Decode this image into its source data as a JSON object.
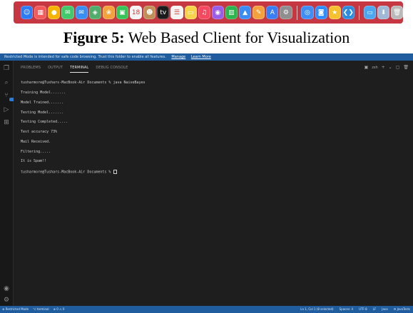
{
  "dock": {
    "apps": [
      {
        "name": "finder-icon",
        "glyph": "☺",
        "color": "#2d7cf6"
      },
      {
        "name": "launchpad-icon",
        "glyph": "▦",
        "color": "#f25a5a"
      },
      {
        "name": "chrome-icon",
        "glyph": "●",
        "color": "#f5b400"
      },
      {
        "name": "messages-icon",
        "glyph": "✉",
        "color": "#42c96b"
      },
      {
        "name": "mail-icon",
        "glyph": "✉",
        "color": "#3a8ef3"
      },
      {
        "name": "maps-icon",
        "glyph": "◈",
        "color": "#4fae6b"
      },
      {
        "name": "photos-icon",
        "glyph": "❀",
        "color": "#f2a13b"
      },
      {
        "name": "facetime-icon",
        "glyph": "▣",
        "color": "#36c657"
      },
      {
        "name": "calendar-icon",
        "glyph": "18",
        "color": "#f5f5f5"
      },
      {
        "name": "contacts-icon",
        "glyph": "☻",
        "color": "#bf8f58"
      },
      {
        "name": "apple-tv-icon",
        "glyph": "tv",
        "color": "#1b1b1b"
      },
      {
        "name": "reminders-icon",
        "glyph": "☰",
        "color": "#f4f4f4"
      },
      {
        "name": "notes-icon",
        "glyph": "▭",
        "color": "#f5d34a"
      },
      {
        "name": "music-icon",
        "glyph": "♫",
        "color": "#f6485e"
      },
      {
        "name": "podcasts-icon",
        "glyph": "◉",
        "color": "#9a5de8"
      },
      {
        "name": "numbers-icon",
        "glyph": "▥",
        "color": "#2cb44f"
      },
      {
        "name": "keynote-icon",
        "glyph": "▲",
        "color": "#3b8bf5"
      },
      {
        "name": "pages-icon",
        "glyph": "✎",
        "color": "#f3a03d"
      },
      {
        "name": "app-store-icon",
        "glyph": "A",
        "color": "#3a7ef3"
      },
      {
        "name": "system-settings-icon",
        "glyph": "⚙",
        "color": "#8f8f8f"
      },
      {
        "name": "safari-icon",
        "glyph": "◎",
        "color": "#3e8ef5"
      },
      {
        "name": "zoom-icon",
        "glyph": "◙",
        "color": "#2d8cff"
      },
      {
        "name": "favorites-icon",
        "glyph": "★",
        "color": "#f5c12e"
      },
      {
        "name": "vscode-icon",
        "glyph": "❮❯",
        "color": "#2c8ddf"
      },
      {
        "name": "folder-icon",
        "glyph": "▭",
        "color": "#4da7f0"
      },
      {
        "name": "downloads-icon",
        "glyph": "⬇",
        "color": "#9fb8d6"
      },
      {
        "name": "trash-icon",
        "glyph": "🗑",
        "color": "#b9b9b9"
      }
    ]
  },
  "caption": {
    "label": "Figure 5:",
    "text": " Web Based Client for Visualization"
  },
  "banner": {
    "message": "Restricted Mode is intended for safe code browsing. Trust this folder to enable all features.",
    "manage": "Manage",
    "learn_more": "Learn More"
  },
  "panel": {
    "tabs": [
      "PROBLEMS",
      "OUTPUT",
      "TERMINAL",
      "DEBUG CONSOLE"
    ],
    "active_tab": "TERMINAL",
    "shell": "zsh",
    "actions": [
      "+",
      "⌄",
      "▢",
      "🗑"
    ]
  },
  "terminal": {
    "lines": [
      "tusharmore@Tushars-MacBook-Air Documents % java NaiveBayes",
      "Training Model.......",
      "Model Trained.......",
      "Testing Model.......",
      "Testing Completed.....",
      "Test accuracy 73%",
      "Mail Received.",
      "Filtering.....",
      "It is Spam!!",
      "tusharmore@Tushars-MacBook-Air Documents % "
    ]
  },
  "status": {
    "left": [
      "⊗ Restricted Mode",
      "⌥ terminal",
      "⊗ 0 ⚠ 0"
    ],
    "right": [
      "Ln 1, Col 1 (8 selected)",
      "Spaces: 4",
      "UTF-8",
      "LF",
      "Java",
      "⚙ JavaTests"
    ]
  },
  "colors": {
    "dock_bg": "#c63742",
    "editor_bg": "#1e1e1e",
    "banner_bg": "#1f5d9e",
    "status_bg": "#1f5d9e"
  }
}
